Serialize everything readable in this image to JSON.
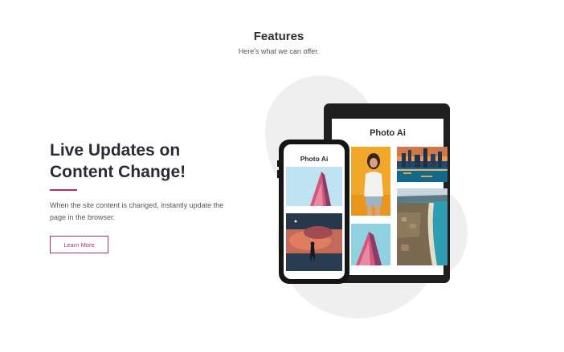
{
  "features": {
    "title": "Features",
    "subtitle": "Here's what we can offer."
  },
  "feature": {
    "heading_line1": "Live Updates on",
    "heading_line2": "Content Change!",
    "description": "When the site content is changed, instantly update the page in the browser.",
    "button_label": "Learn More"
  },
  "devices": {
    "tablet_app_title": "Photo Ai",
    "phone_app_title": "Photo Ai"
  },
  "colors": {
    "accent": "#a8336d",
    "heading": "#2b2b36",
    "device": "#1f1f1f",
    "blob": "#efefef"
  }
}
